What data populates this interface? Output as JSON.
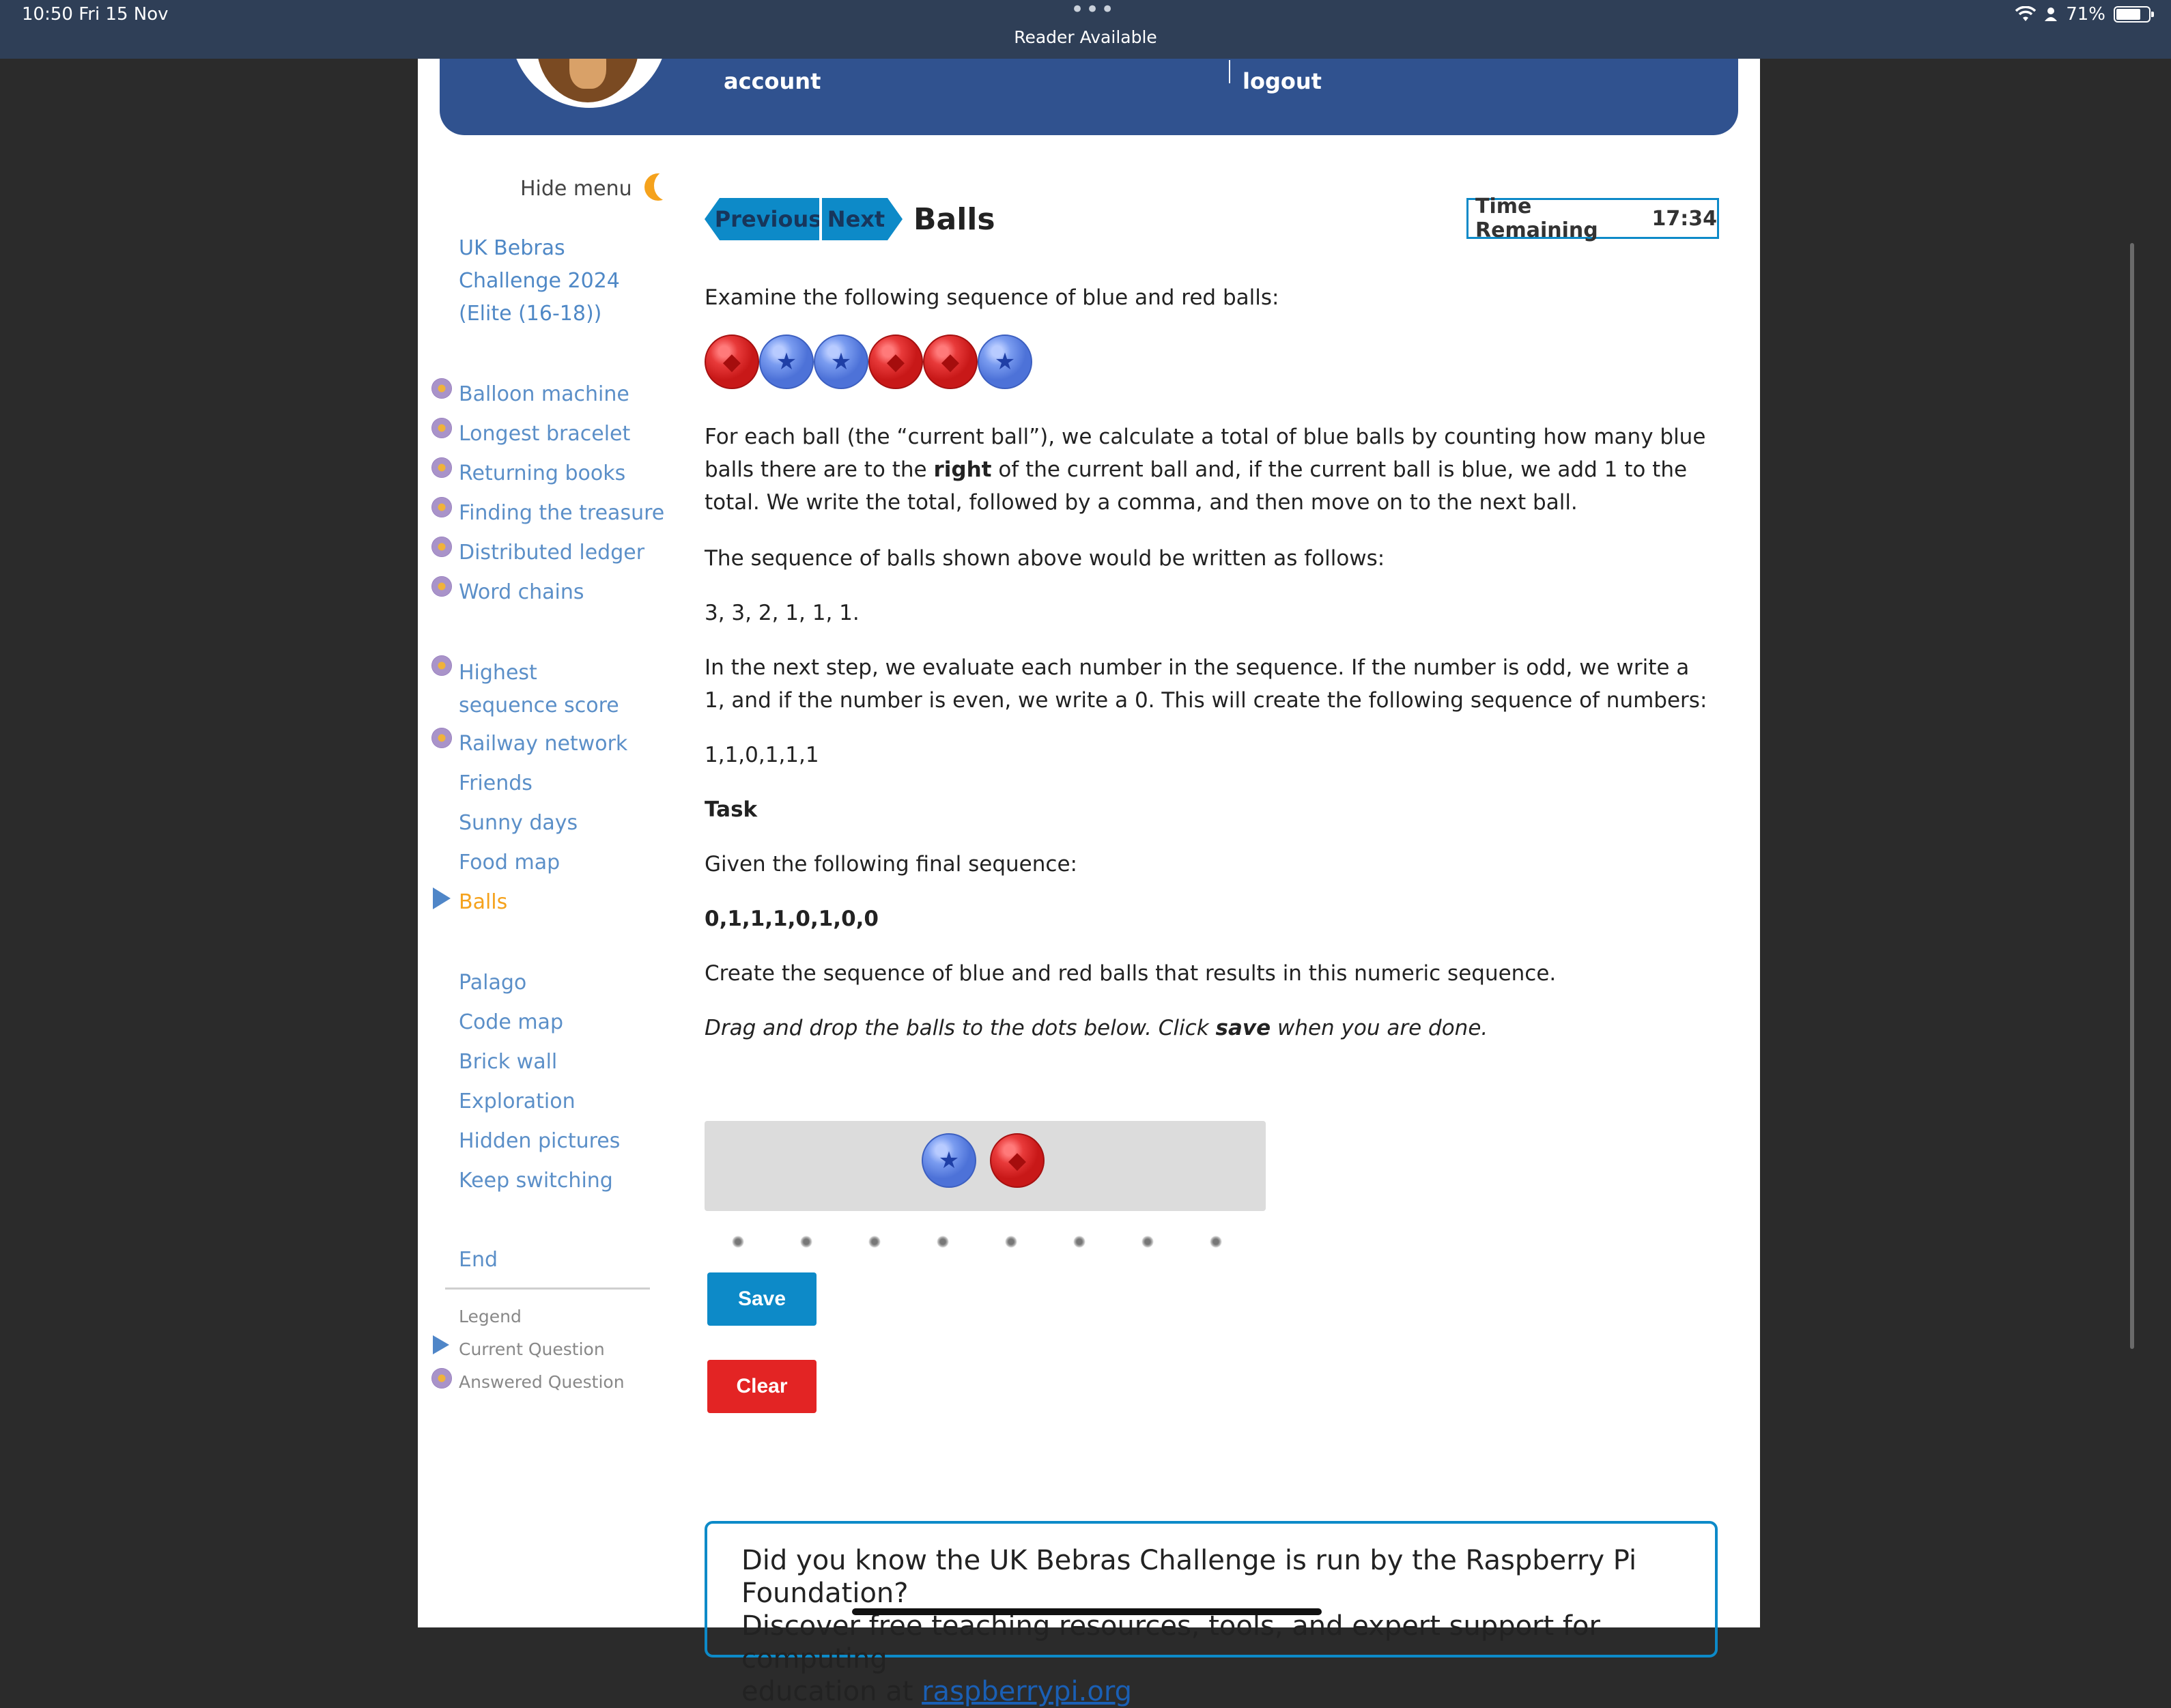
{
  "status_bar": {
    "time": "10:50  Fri 15 Nov",
    "dots": "•••",
    "reader": "Reader Available",
    "battery": "71%"
  },
  "header": {
    "account": "account",
    "logout": "logout"
  },
  "sidebar": {
    "hide_menu": "Hide menu",
    "competition": "UK Bebras Challenge 2024 (Elite (16-18))",
    "group1": [
      "Balloon machine",
      "Longest bracelet",
      "Returning books",
      "Finding the treasure",
      "Distributed ledger",
      "Word chains"
    ],
    "group2": [
      "Highest sequence score",
      "Railway network",
      "Friends",
      "Sunny days",
      "Food map",
      "Balls"
    ],
    "group3": [
      "Palago",
      "Code map",
      "Brick wall",
      "Exploration",
      "Hidden pictures",
      "Keep switching"
    ],
    "end": "End",
    "legend_title": "Legend",
    "legend_current": "Current Question",
    "legend_answered": "Answered Question"
  },
  "question": {
    "prev": "Previous",
    "next": "Next",
    "title": "Balls",
    "timer_label": "Time Remaining",
    "timer_value": "17:34",
    "intro": "Examine the following sequence of blue and red balls:",
    "example_balls": [
      "red",
      "blue",
      "blue",
      "red",
      "red",
      "blue"
    ],
    "para1_a": "For each ball (the “current ball”), we calculate a total of blue balls by counting how many blue balls there are to the ",
    "para1_bold": "right",
    "para1_b": " of the current ball and, if the current ball is blue, we add 1 to the total. We write the total, followed by a comma, and then move on to the next ball.",
    "para2": "The sequence of balls shown above would be written as follows:",
    "seq1": "3, 3, 2, 1, 1, 1.",
    "para3": "In the next step, we evaluate each number in the sequence. If the number is odd, we write a 1, and if the number is even, we write a 0. This will create the following sequence of numbers:",
    "seq2": "1,1,0,1,1,1",
    "task_heading": "Task",
    "para4": "Given the following final sequence:",
    "seq3": "0,1,1,1,0,1,0,0",
    "para5": "Create the sequence of blue and red balls that results in this numeric sequence.",
    "instr_a": "Drag and drop the balls to the dots below. Click ",
    "instr_bold": "save",
    "instr_b": " when you are done.",
    "tray_balls": [
      "blue",
      "red"
    ],
    "drop_slots": 8,
    "save": "Save",
    "clear": "Clear"
  },
  "promo": {
    "line1": "Did you know the UK Bebras Challenge is run by the Raspberry Pi Foundation?",
    "line2": "Discover free teaching resources, tools, and expert support for computing",
    "line3_a": "education at ",
    "line3_link": "raspberrypi.org"
  },
  "colors": {
    "header_blue": "#30528f",
    "accent_blue": "#0d8ac8",
    "current_orange": "#f5a21c",
    "clear_red": "#e32424"
  }
}
